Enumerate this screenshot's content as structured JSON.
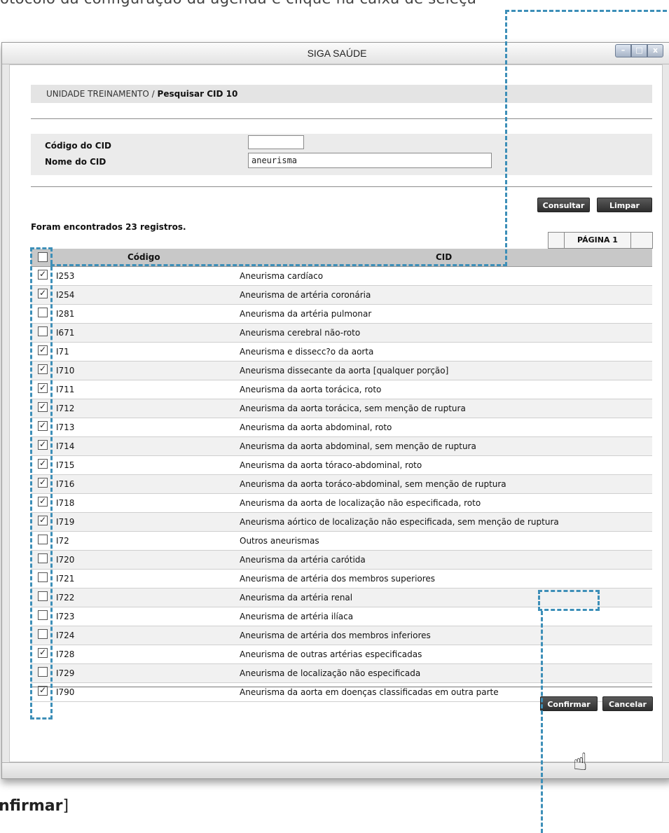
{
  "caption_top": "otocolo da configuração da agenda e clique na caixa de seleçã",
  "caption_bottom": {
    "prefix": "nfirmar",
    "suffix": "]"
  },
  "window": {
    "title": "SIGA SAÚDE",
    "controls": {
      "minimize": "–",
      "maximize": "□",
      "close": "x"
    }
  },
  "breadcrumb": {
    "root": "UNIDADE TREINAMENTO /",
    "current": "Pesquisar CID 10"
  },
  "form": {
    "codigo_label": "Código do CID",
    "codigo_value": "",
    "nome_label": "Nome do CID",
    "nome_value": "aneurisma"
  },
  "buttons": {
    "consultar": "Consultar",
    "limpar": "Limpar",
    "confirmar": "Confirmar",
    "cancelar": "Cancelar"
  },
  "results_text": "Foram encontrados 23 registros.",
  "pager": {
    "label": "PÁGINA 1"
  },
  "table": {
    "headers": {
      "code": "Código",
      "cid": "CID"
    },
    "header_checked": false,
    "rows": [
      {
        "code": "I253",
        "desc": "Aneurisma cardíaco",
        "checked": true
      },
      {
        "code": "I254",
        "desc": "Aneurisma de artéria coronária",
        "checked": true
      },
      {
        "code": "I281",
        "desc": "Aneurisma da artéria pulmonar",
        "checked": false
      },
      {
        "code": "I671",
        "desc": "Aneurisma cerebral não-roto",
        "checked": false
      },
      {
        "code": "I71",
        "desc": "Aneurisma e dissecc?o da aorta",
        "checked": true
      },
      {
        "code": "I710",
        "desc": "Aneurisma dissecante da aorta [qualquer porção]",
        "checked": true
      },
      {
        "code": "I711",
        "desc": "Aneurisma da aorta torácica, roto",
        "checked": true
      },
      {
        "code": "I712",
        "desc": "Aneurisma da aorta torácica, sem menção de ruptura",
        "checked": true
      },
      {
        "code": "I713",
        "desc": "Aneurisma da aorta abdominal, roto",
        "checked": true
      },
      {
        "code": "I714",
        "desc": "Aneurisma da aorta abdominal, sem menção de ruptura",
        "checked": true
      },
      {
        "code": "I715",
        "desc": "Aneurisma da aorta tóraco-abdominal, roto",
        "checked": true
      },
      {
        "code": "I716",
        "desc": "Aneurisma da aorta toráco-abdominal, sem menção de ruptura",
        "checked": true
      },
      {
        "code": "I718",
        "desc": "Aneurisma da aorta de localização não especificada, roto",
        "checked": true
      },
      {
        "code": "I719",
        "desc": "Aneurisma aórtico de localização não especificada, sem menção de ruptura",
        "checked": true
      },
      {
        "code": "I72",
        "desc": "Outros aneurismas",
        "checked": false
      },
      {
        "code": "I720",
        "desc": "Aneurisma da artéria carótida",
        "checked": false
      },
      {
        "code": "I721",
        "desc": "Aneurisma de artéria dos membros superiores",
        "checked": false
      },
      {
        "code": "I722",
        "desc": "Aneurisma da artéria renal",
        "checked": false
      },
      {
        "code": "I723",
        "desc": "Aneurisma de artéria ilíaca",
        "checked": false
      },
      {
        "code": "I724",
        "desc": "Aneurisma de artéria dos membros inferiores",
        "checked": false
      },
      {
        "code": "I728",
        "desc": "Aneurisma de outras artérias especificadas",
        "checked": true
      },
      {
        "code": "I729",
        "desc": "Aneurisma de localização não especificada",
        "checked": false
      },
      {
        "code": "I790",
        "desc": "Aneurisma da aorta em doenças classificadas em outra parte",
        "checked": true
      }
    ]
  },
  "colors": {
    "highlight": "#3d8fb8",
    "button": "#3a3a3a",
    "header": "#c8c8c8"
  }
}
